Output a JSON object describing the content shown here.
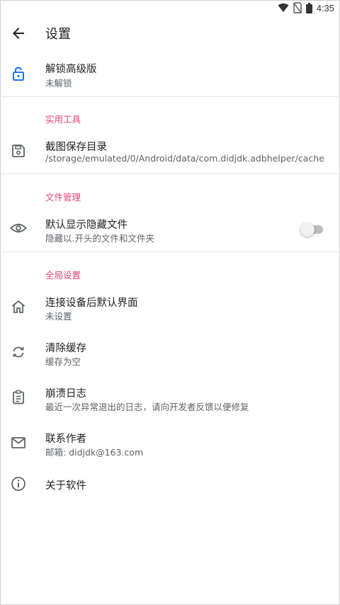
{
  "status_bar": {
    "time": "4:35",
    "icons": [
      "wifi-icon",
      "no-sim-icon",
      "battery-icon"
    ]
  },
  "app_bar": {
    "title": "设置",
    "back_icon": "arrow-back-icon"
  },
  "colors": {
    "accent": "#1a73e8",
    "category": "#e0457b",
    "text": "#202124",
    "secondary": "#5f6368",
    "divider": "#e3e3e3"
  },
  "premium": {
    "title": "解锁高级版",
    "subtitle": "未解锁",
    "icon": "lock-open-icon"
  },
  "tools": {
    "category": "实用工具",
    "screenshot_dir": {
      "title": "截图保存目录",
      "subtitle": "/storage/emulated/0/Android/data/com.didjdk.adbhelper/cache",
      "icon": "save-icon"
    }
  },
  "files": {
    "category": "文件管理",
    "show_hidden": {
      "title": "默认显示隐藏文件",
      "subtitle": "隐藏以.开头的文件和文件夹",
      "icon": "eye-icon",
      "enabled": false
    }
  },
  "global": {
    "category": "全局设置",
    "default_screen": {
      "title": "连接设备后默认界面",
      "subtitle": "未设置",
      "icon": "home-icon"
    },
    "clear_cache": {
      "title": "清除缓存",
      "subtitle": "缓存为空",
      "icon": "sync-icon"
    },
    "crash_log": {
      "title": "崩溃日志",
      "subtitle": "最近一次异常退出的日志，请向开发者反馈以便修复",
      "icon": "clipboard-icon"
    },
    "contact": {
      "title": "联系作者",
      "subtitle": "邮箱: didjdk@163.com",
      "icon": "mail-icon"
    },
    "about": {
      "title": "关于软件",
      "icon": "info-icon"
    }
  }
}
